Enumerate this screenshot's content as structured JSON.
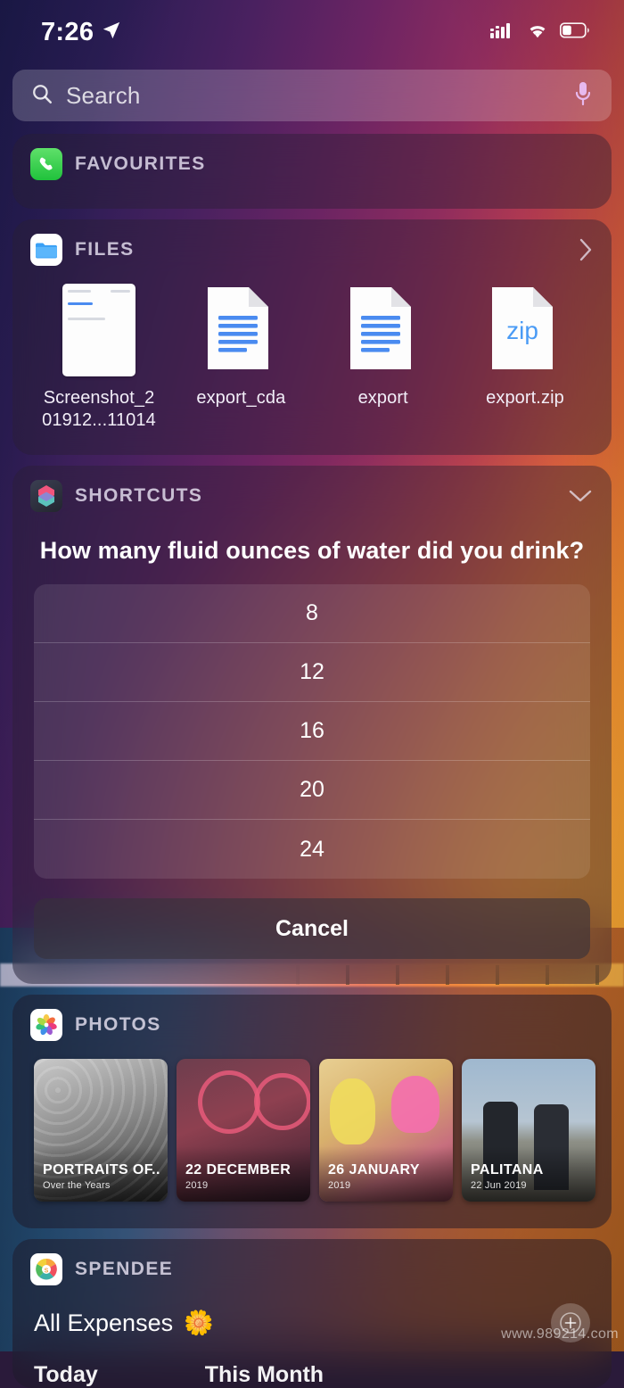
{
  "status_bar": {
    "time": "7:26",
    "location_icon": "location-arrow-icon",
    "signal_icon": "cellular-signal-icon",
    "wifi_icon": "wifi-icon",
    "battery_icon": "battery-icon",
    "battery_level_percent": 35
  },
  "search": {
    "placeholder": "Search",
    "value": "",
    "search_icon": "search-icon",
    "mic_icon": "microphone-icon"
  },
  "widgets": {
    "favourites": {
      "title": "FAVOURITES",
      "icon": "phone-app-icon"
    },
    "files": {
      "title": "FILES",
      "icon": "files-app-icon",
      "chevron": "chevron-right-icon",
      "items": [
        {
          "label": "Screenshot_2\n01912...11014",
          "label_line1": "Screenshot_2",
          "label_line2": "01912...11014",
          "kind": "screenshot"
        },
        {
          "label": "export_cda",
          "kind": "document"
        },
        {
          "label": "export",
          "kind": "document"
        },
        {
          "label": "export.zip",
          "kind": "zip",
          "badge": "zip"
        }
      ]
    },
    "shortcuts": {
      "title": "SHORTCUTS",
      "icon": "shortcuts-app-icon",
      "chevron": "chevron-down-icon",
      "question": "How many fluid ounces of water did you drink?",
      "options": [
        "8",
        "12",
        "16",
        "20",
        "24"
      ],
      "cancel_label": "Cancel"
    },
    "photos": {
      "title": "PHOTOS",
      "icon": "photos-app-icon",
      "memories": [
        {
          "title": "PORTRAITS OF...",
          "subtitle": "Over the Years"
        },
        {
          "title": "22 DECEMBER",
          "subtitle": "2019"
        },
        {
          "title": "26 JANUARY",
          "subtitle": "2019"
        },
        {
          "title": "PALITANA",
          "subtitle": "22 Jun 2019"
        }
      ]
    },
    "spendee": {
      "title": "SPENDEE",
      "icon": "spendee-app-icon",
      "account_label": "All Expenses",
      "account_emoji": "🌼",
      "add_icon": "plus-circle-icon",
      "stats": [
        {
          "label": "Today"
        },
        {
          "label": "This Month"
        }
      ]
    }
  },
  "watermark": "www.989214.com",
  "colors": {
    "accent_green": "#34c759",
    "accent_blue": "#4a8bf0",
    "text_primary": "#ffffff",
    "widget_title": "#cfc8dd"
  }
}
